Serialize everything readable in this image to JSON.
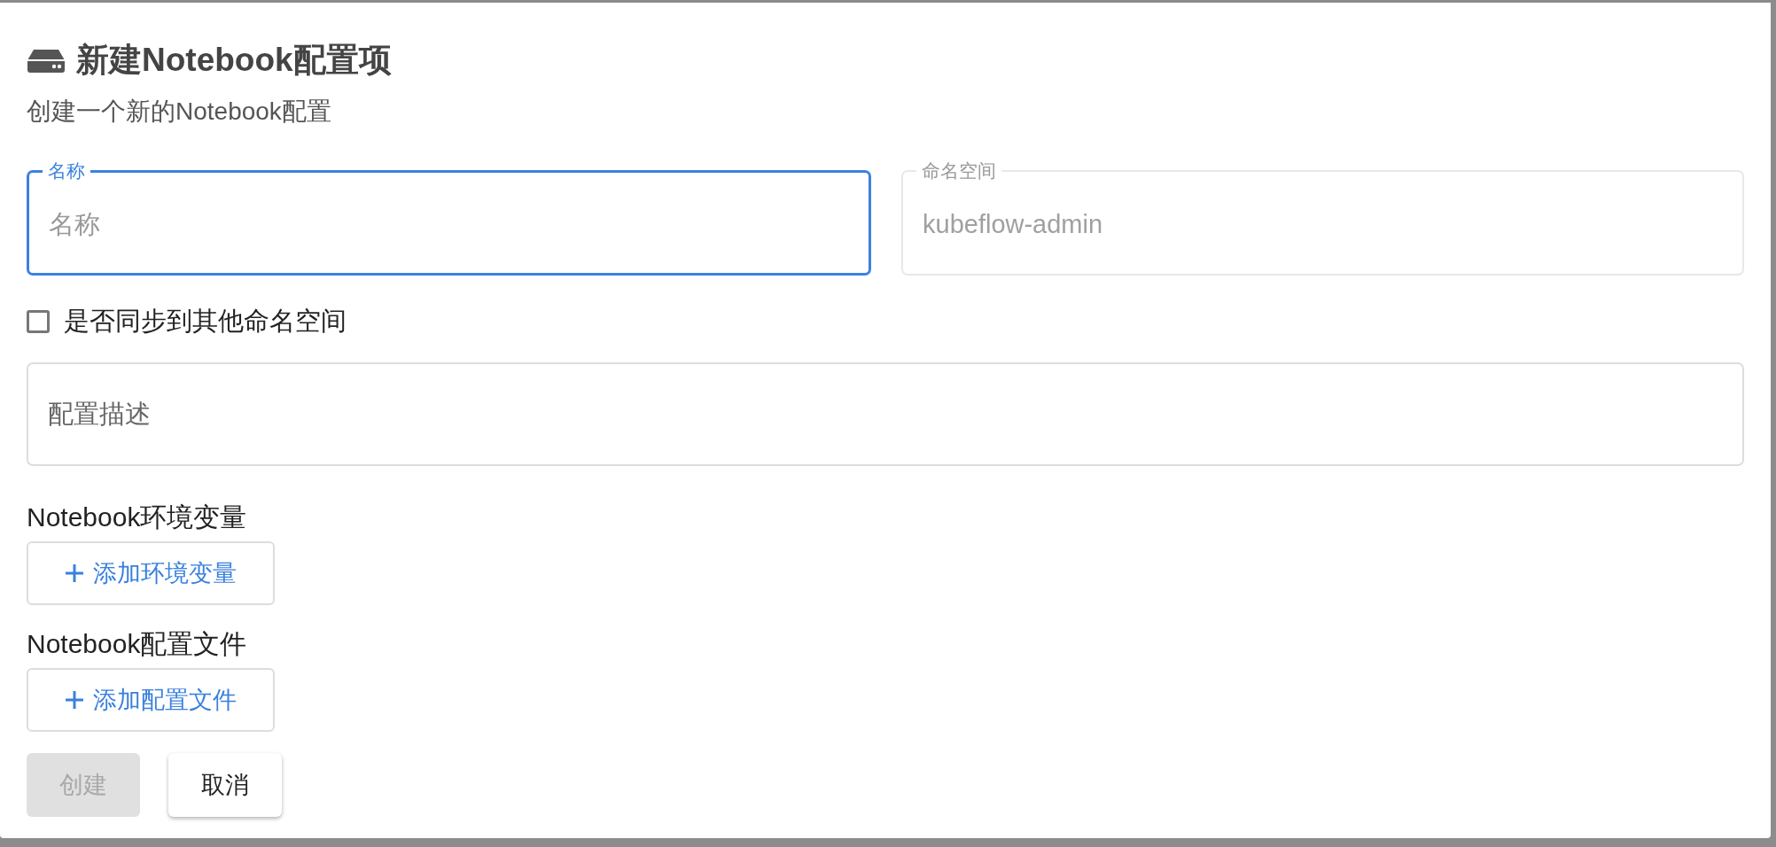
{
  "dialog": {
    "title": "新建Notebook配置项",
    "subtitle": "创建一个新的Notebook配置"
  },
  "fields": [
    {
      "label": "名称",
      "placeholder": "名称",
      "focused": true,
      "disabled": false
    },
    {
      "label": "命名空间",
      "value": "kubeflow-admin",
      "focused": false,
      "disabled": true
    }
  ],
  "sync_checkbox": {
    "label": "是否同步到其他命名空间",
    "checked": false
  },
  "description": {
    "placeholder": "配置描述"
  },
  "sections": [
    {
      "label": "Notebook环境变量",
      "button": "添加环境变量"
    },
    {
      "label": "Notebook配置文件",
      "button": "添加配置文件"
    }
  ],
  "actions": [
    {
      "kind": "primary",
      "label": "创建",
      "disabled": true
    },
    {
      "kind": "secondary",
      "label": "取消",
      "disabled": false
    }
  ]
}
